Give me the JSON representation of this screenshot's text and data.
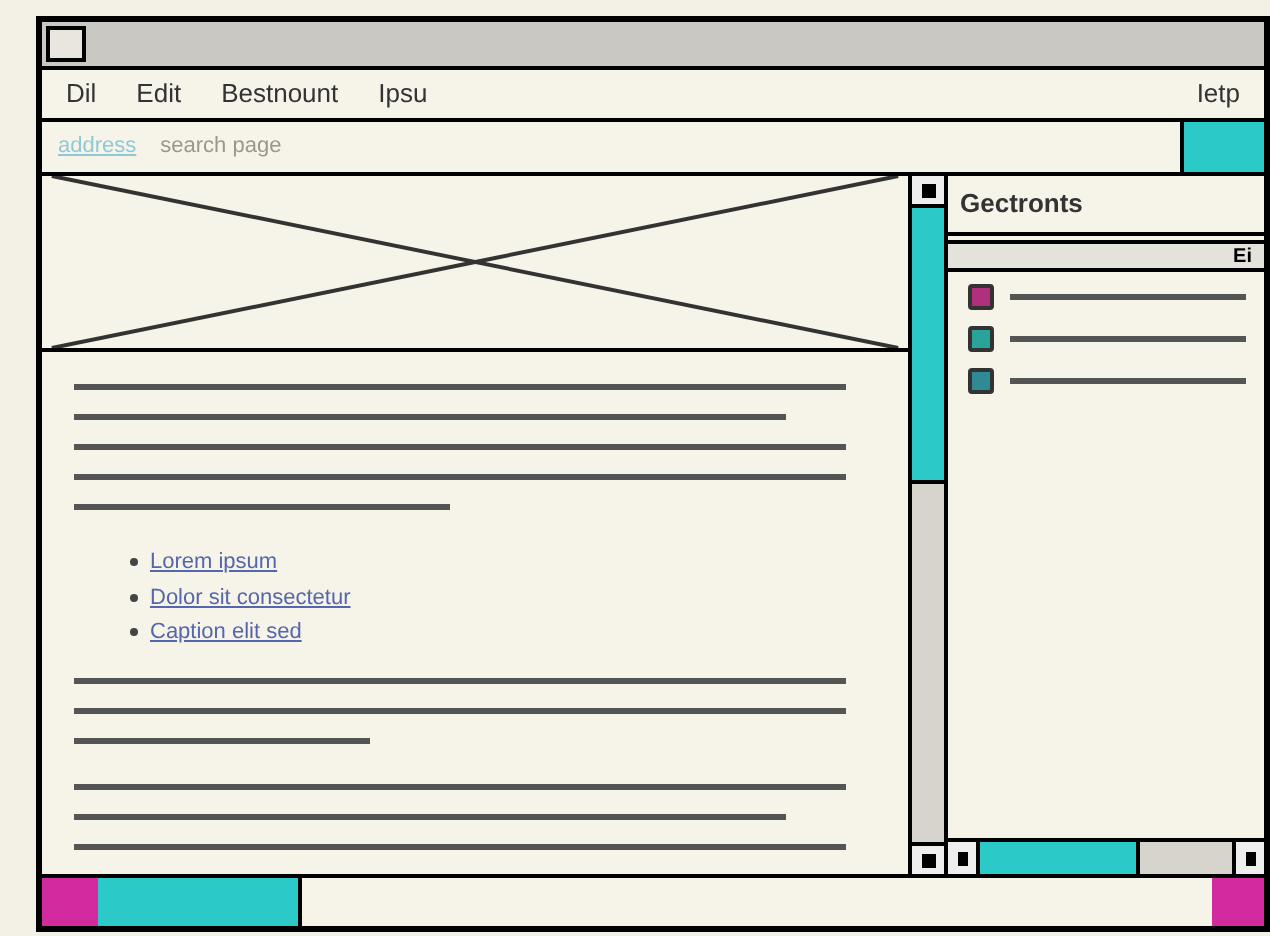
{
  "menu": [
    {
      "label": "Dil"
    },
    {
      "label": "Edit"
    },
    {
      "label": "Bestnount"
    },
    {
      "label": "Ipsu"
    }
  ],
  "help_menu": {
    "label": "Ietp"
  },
  "address_bar": {
    "value": "address",
    "placeholder": "search page"
  },
  "content": {
    "image": {
      "kind": "placeholder"
    },
    "links": [
      {
        "label": "Lorem ipsum"
      },
      {
        "label": "Dolor sit consectetur"
      },
      {
        "label": "Caption elit sed"
      }
    ]
  },
  "sidebar": {
    "title": "Gectronts",
    "search_button": "Ei",
    "items": [
      {
        "color": "#b0307e"
      },
      {
        "color": "#2aa39b"
      },
      {
        "color": "#2f8a95"
      }
    ]
  }
}
